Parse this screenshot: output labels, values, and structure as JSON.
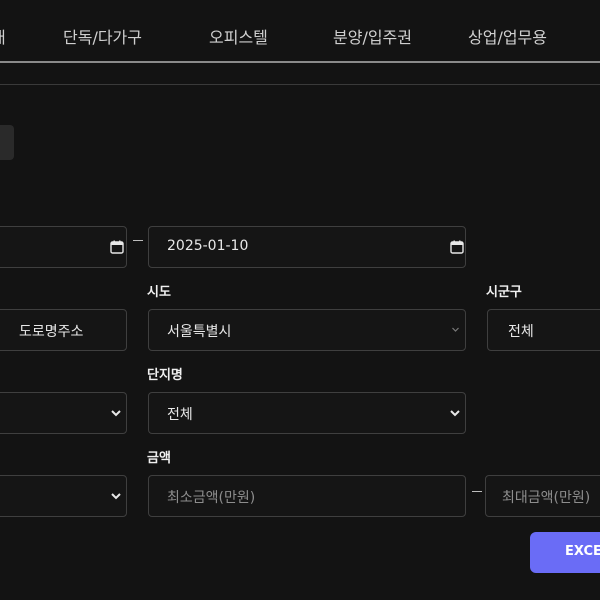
{
  "nav": {
    "tabs": [
      "대",
      "단독/다가구",
      "오피스텔",
      "분양/입주권",
      "상업/업무용"
    ]
  },
  "filters": {
    "date_separator": "–",
    "date_end": "2025-01-10",
    "address_type": "도로명주소",
    "sido_label": "시도",
    "sido_value": "서울특별시",
    "sigungu_label": "시군구",
    "sigungu_value": "전체",
    "danji_label": "단지명",
    "danji_value": "전체",
    "price_label": "금액",
    "price_min_placeholder": "최소금액(만원)",
    "price_max_placeholder": "최대금액(만원)",
    "price_separator": "–"
  },
  "actions": {
    "excel_label": "EXCEL"
  }
}
